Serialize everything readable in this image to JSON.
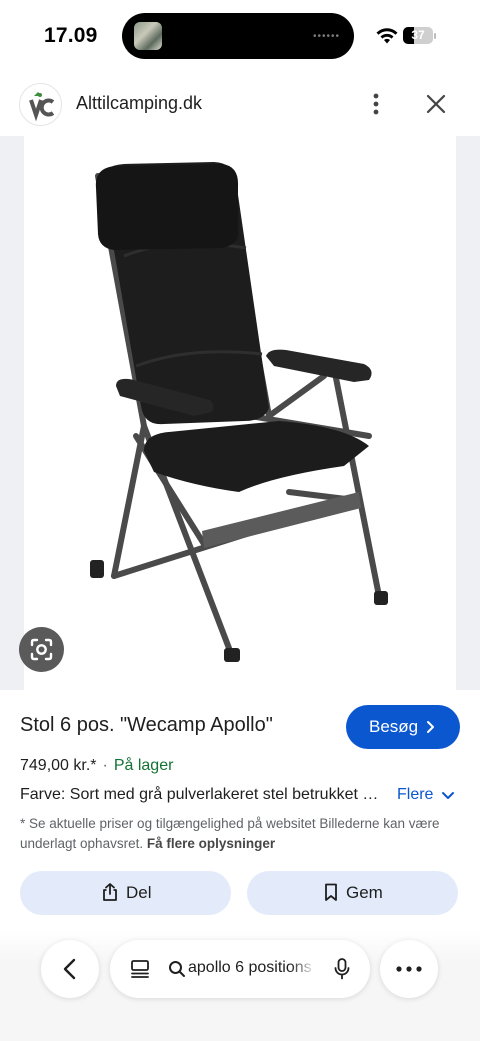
{
  "status_bar": {
    "time": "17.09",
    "battery_level": "37",
    "battery_fraction": 0.37,
    "icons": [
      "wifi-icon",
      "battery-icon"
    ]
  },
  "site": {
    "name": "Alttilcamping.dk",
    "logo_text": "VC",
    "icons": [
      "more-vertical-icon",
      "close-icon"
    ]
  },
  "image": {
    "subject": "chair",
    "lens_icon": "lens-icon"
  },
  "product": {
    "title": "Stol 6 pos. \"Wecamp Apollo\"",
    "visit_label": "Besøg",
    "price": "749,00 kr.*",
    "separator": "·",
    "stock": "På lager",
    "color_line": "Farve: Sort med grå pulverlakeret stel betrukket med sort stof",
    "more_label": "Flere",
    "disclaimer": "* Se aktuelle priser og tilgængelighed på websitet Billederne kan være underlagt ophavsret.",
    "disclaimer_link": "Få flere oplysninger",
    "share_label": "Del",
    "save_label": "Gem"
  },
  "bottom_nav": {
    "query": "apollo 6 positions",
    "icons": [
      "back-icon",
      "tabs-icon",
      "search-icon",
      "mic-icon",
      "more-horizontal-icon"
    ]
  },
  "colors": {
    "accent": "#0b57d0",
    "stock_green": "#137333",
    "chip_bg": "#e3ebfa"
  }
}
